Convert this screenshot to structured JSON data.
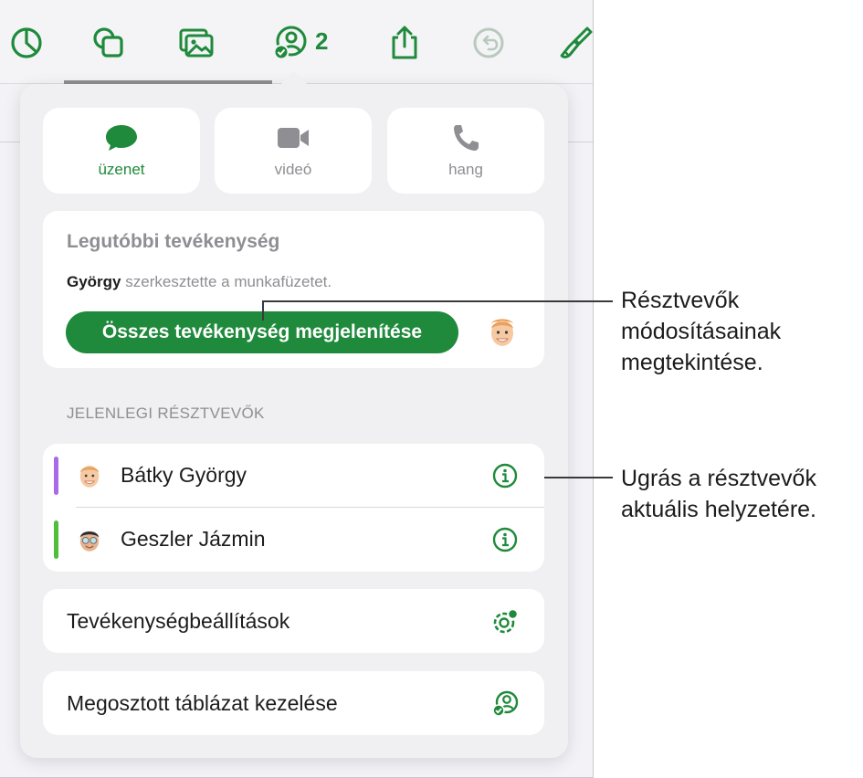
{
  "toolbar": {
    "collab_count": "2"
  },
  "communication": {
    "message_label": "üzenet",
    "video_label": "videó",
    "audio_label": "hang"
  },
  "activity": {
    "title": "Legutóbbi tevékenység",
    "editor_name": "György",
    "action_text": "szerkesztette a munkafüzetet.",
    "show_all_label": "Összes tevékenység megjelenítése"
  },
  "participants": {
    "header": "JELENLEGI RÉSZTVEVŐK",
    "items": [
      {
        "name": "Bátky György",
        "color": "#a86ae8"
      },
      {
        "name": "Geszler Jázmin",
        "color": "#4fbf3a"
      }
    ]
  },
  "rows": {
    "activity_settings": "Tevékenységbeállítások",
    "manage_shared": "Megosztott táblázat kezelése"
  },
  "callouts": {
    "changes": "Résztvevők\nmódosításainak\nmegtekintése.",
    "jump": "Ugrás a résztvevők\naktuális helyzetére."
  },
  "colors": {
    "accent": "#1f8a3b",
    "secondary_text": "#8e8e93",
    "panel": "#f0f0f2"
  }
}
